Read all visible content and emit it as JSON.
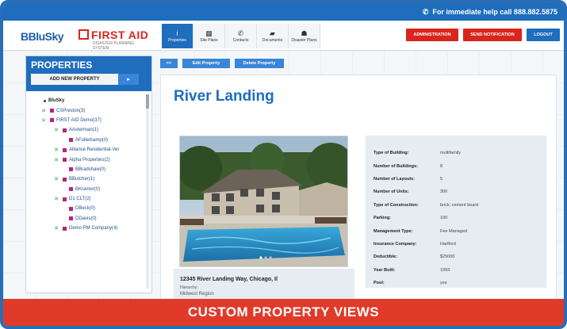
{
  "top_strip": {
    "help_text": "For immediate help call 888.882.5875",
    "phone_icon": "phone-icon"
  },
  "logos": {
    "blusky_mark": "B",
    "blusky": "BluSky",
    "firstaid": "FIRST AID",
    "firstaid_sub": "DISASTER PLANNING SYSTEM"
  },
  "nav": {
    "tabs": [
      {
        "label": "Properties",
        "icon": "info-icon",
        "glyph": "i",
        "active": true
      },
      {
        "label": "Site Plans",
        "icon": "grid-icon",
        "glyph": "▦",
        "active": false
      },
      {
        "label": "Contacts",
        "icon": "phone-icon",
        "glyph": "✆",
        "active": false
      },
      {
        "label": "Documents",
        "icon": "folder-icon",
        "glyph": "▰",
        "active": false
      },
      {
        "label": "Disaster Plans",
        "icon": "person-icon",
        "glyph": "☗",
        "active": false
      }
    ]
  },
  "header_buttons": {
    "admin": "ADMINISTRATION",
    "notify": "SEND NOTIFICATION",
    "logout": "LOGOUT"
  },
  "sidebar": {
    "title": "PROPERTIES",
    "add_label": "ADD NEW PROPERTY",
    "add_arrow": "▸",
    "tree": [
      {
        "label": "BluSky",
        "exp": "",
        "root": true,
        "indent": 0
      },
      {
        "label": "CSPreston(3)",
        "exp": "⊞",
        "root": false,
        "indent": 1
      },
      {
        "label": "FIRST AID Demo(37)",
        "exp": "⊟",
        "root": false,
        "indent": 1
      },
      {
        "label": "AAsterman(1)",
        "exp": "⊞",
        "root": false,
        "indent": 3
      },
      {
        "label": "AFullerkamp(0)",
        "exp": "",
        "root": false,
        "indent": 4
      },
      {
        "label": "Alliance Residential-Ver",
        "exp": "⊞",
        "root": false,
        "indent": 3
      },
      {
        "label": "Alpha Properties(2)",
        "exp": "⊞",
        "root": false,
        "indent": 3
      },
      {
        "label": "BBradshaw(0)",
        "exp": "",
        "root": false,
        "indent": 4
      },
      {
        "label": "BButcher(1)",
        "exp": "⊞",
        "root": false,
        "indent": 3
      },
      {
        "label": "BKramer(0)",
        "exp": "",
        "root": false,
        "indent": 4
      },
      {
        "label": "D1 CLT(2)",
        "exp": "⊞",
        "root": false,
        "indent": 3
      },
      {
        "label": "DBeck(0)",
        "exp": "",
        "root": false,
        "indent": 4
      },
      {
        "label": "DDavis(0)",
        "exp": "",
        "root": false,
        "indent": 4
      },
      {
        "label": "Demo PM Company(4)",
        "exp": "⊞",
        "root": false,
        "indent": 3
      }
    ]
  },
  "actions": {
    "back": "<<",
    "edit": "Edit Property",
    "delete": "Delete Property"
  },
  "property": {
    "name": "River Landing",
    "address": "12345 River Landing Way, Chicago, Il",
    "hierarchy_label": "Hierarchy:",
    "region": "Midwest Region",
    "details": [
      {
        "k": "Type of Building:",
        "v": "multifamily"
      },
      {
        "k": "Number of Buildings:",
        "v": "8"
      },
      {
        "k": "Number of Layouts:",
        "v": "5"
      },
      {
        "k": "Number of Units:",
        "v": "300"
      },
      {
        "k": "Type of Construction:",
        "v": "brick; cement board"
      },
      {
        "k": "Parking:",
        "v": "100"
      },
      {
        "k": "Management Type:",
        "v": "Fee Managed"
      },
      {
        "k": "Insurance Company:",
        "v": "Hartford"
      },
      {
        "k": "Deductible:",
        "v": "$25000"
      },
      {
        "k": "Year Built:",
        "v": "1993"
      },
      {
        "k": "Pool:",
        "v": "yes"
      }
    ]
  },
  "banner": {
    "text": "CUSTOM PROPERTY VIEWS"
  },
  "colors": {
    "brand_blue": "#1f6dbd",
    "alert_red": "#d9251d",
    "banner_red": "#e03a2a"
  }
}
